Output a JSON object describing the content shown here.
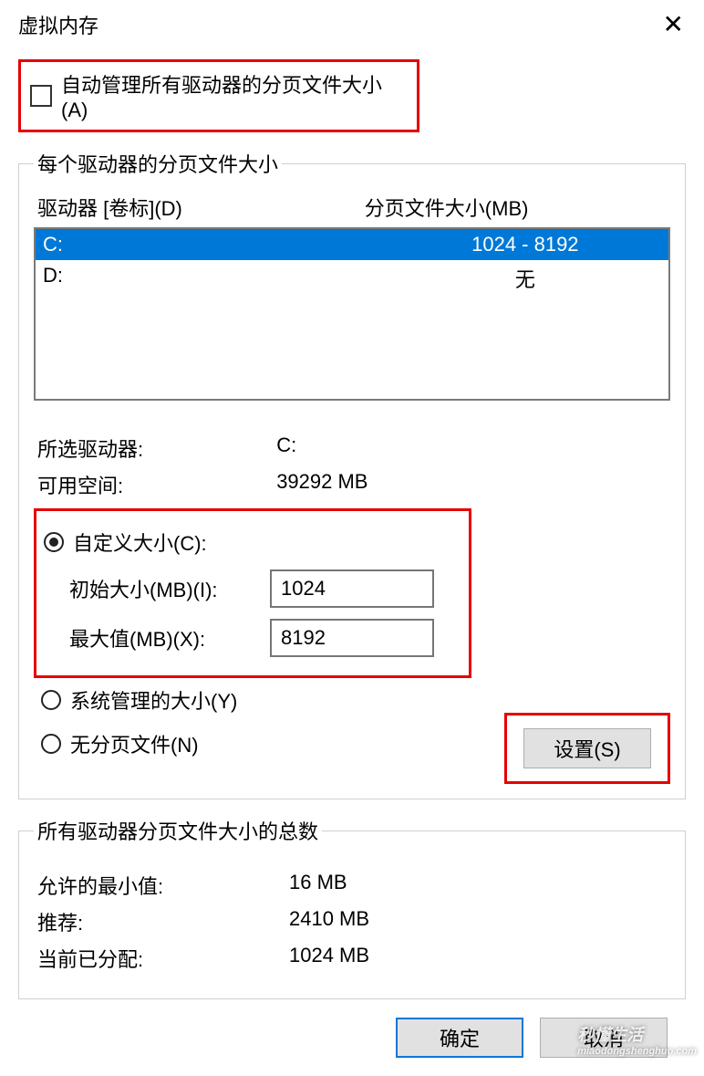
{
  "title": "虚拟内存",
  "close_icon": "close",
  "auto_manage": {
    "label": "自动管理所有驱动器的分页文件大小(A)",
    "checked": false
  },
  "per_drive": {
    "legend": "每个驱动器的分页文件大小",
    "header_drive": "驱动器 [卷标](D)",
    "header_size": "分页文件大小(MB)",
    "rows": [
      {
        "drive": "C:",
        "size": "1024 - 8192",
        "selected": true
      },
      {
        "drive": "D:",
        "size": "无",
        "selected": false
      }
    ],
    "selected_label": "所选驱动器:",
    "selected_value": "C:",
    "free_label": "可用空间:",
    "free_value": "39292 MB",
    "custom_radio": "自定义大小(C):",
    "initial_label": "初始大小(MB)(I):",
    "initial_value": "1024",
    "max_label": "最大值(MB)(X):",
    "max_value": "8192",
    "system_radio": "系统管理的大小(Y)",
    "none_radio": "无分页文件(N)",
    "set_button": "设置(S)",
    "size_mode": "custom"
  },
  "totals": {
    "legend": "所有驱动器分页文件大小的总数",
    "min_label": "允许的最小值:",
    "min_value": "16 MB",
    "rec_label": "推荐:",
    "rec_value": "2410 MB",
    "cur_label": "当前已分配:",
    "cur_value": "1024 MB"
  },
  "footer": {
    "ok": "确定",
    "cancel": "取消"
  },
  "watermark": {
    "line1": "秒懂生活",
    "line2": "miaodongshenghuo.com"
  }
}
